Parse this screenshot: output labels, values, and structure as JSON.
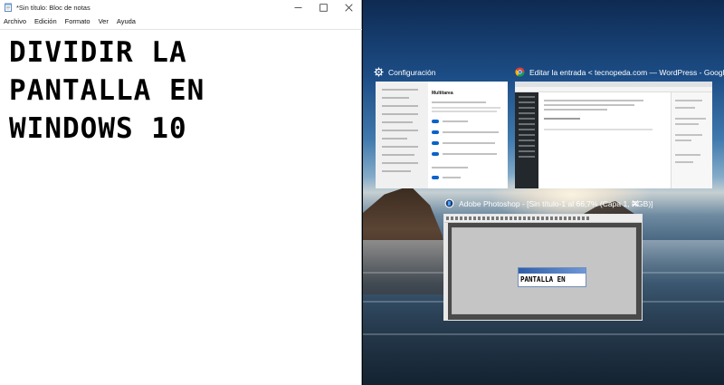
{
  "notepad": {
    "title": "*Sin título: Bloc de notas",
    "menu": [
      "Archivo",
      "Edición",
      "Formato",
      "Ver",
      "Ayuda"
    ],
    "lines": [
      "DIVIDIR LA",
      "PANTALLA EN",
      "WINDOWS 10"
    ],
    "controls": {
      "minimize": "minimize-icon",
      "maximize": "maximize-icon",
      "close": "close-icon"
    }
  },
  "snap_assist": {
    "windows": [
      {
        "title": "Configuración",
        "icon": "gear-icon",
        "content_heading": "Multitarea"
      },
      {
        "title": "Editar la entrada < tecnopeda.com — WordPress - Google...",
        "icon": "chrome-icon"
      },
      {
        "title": "Adobe Photoshop - [Sin título-1 al 66,7% (Capa 1, RGB)]",
        "icon": "photoshop-icon",
        "canvas_text": "PANTALLA EN",
        "close_glyph": "✕"
      }
    ]
  },
  "colors": {
    "accent": "#0a63c9",
    "chrome": "#4285f4"
  }
}
